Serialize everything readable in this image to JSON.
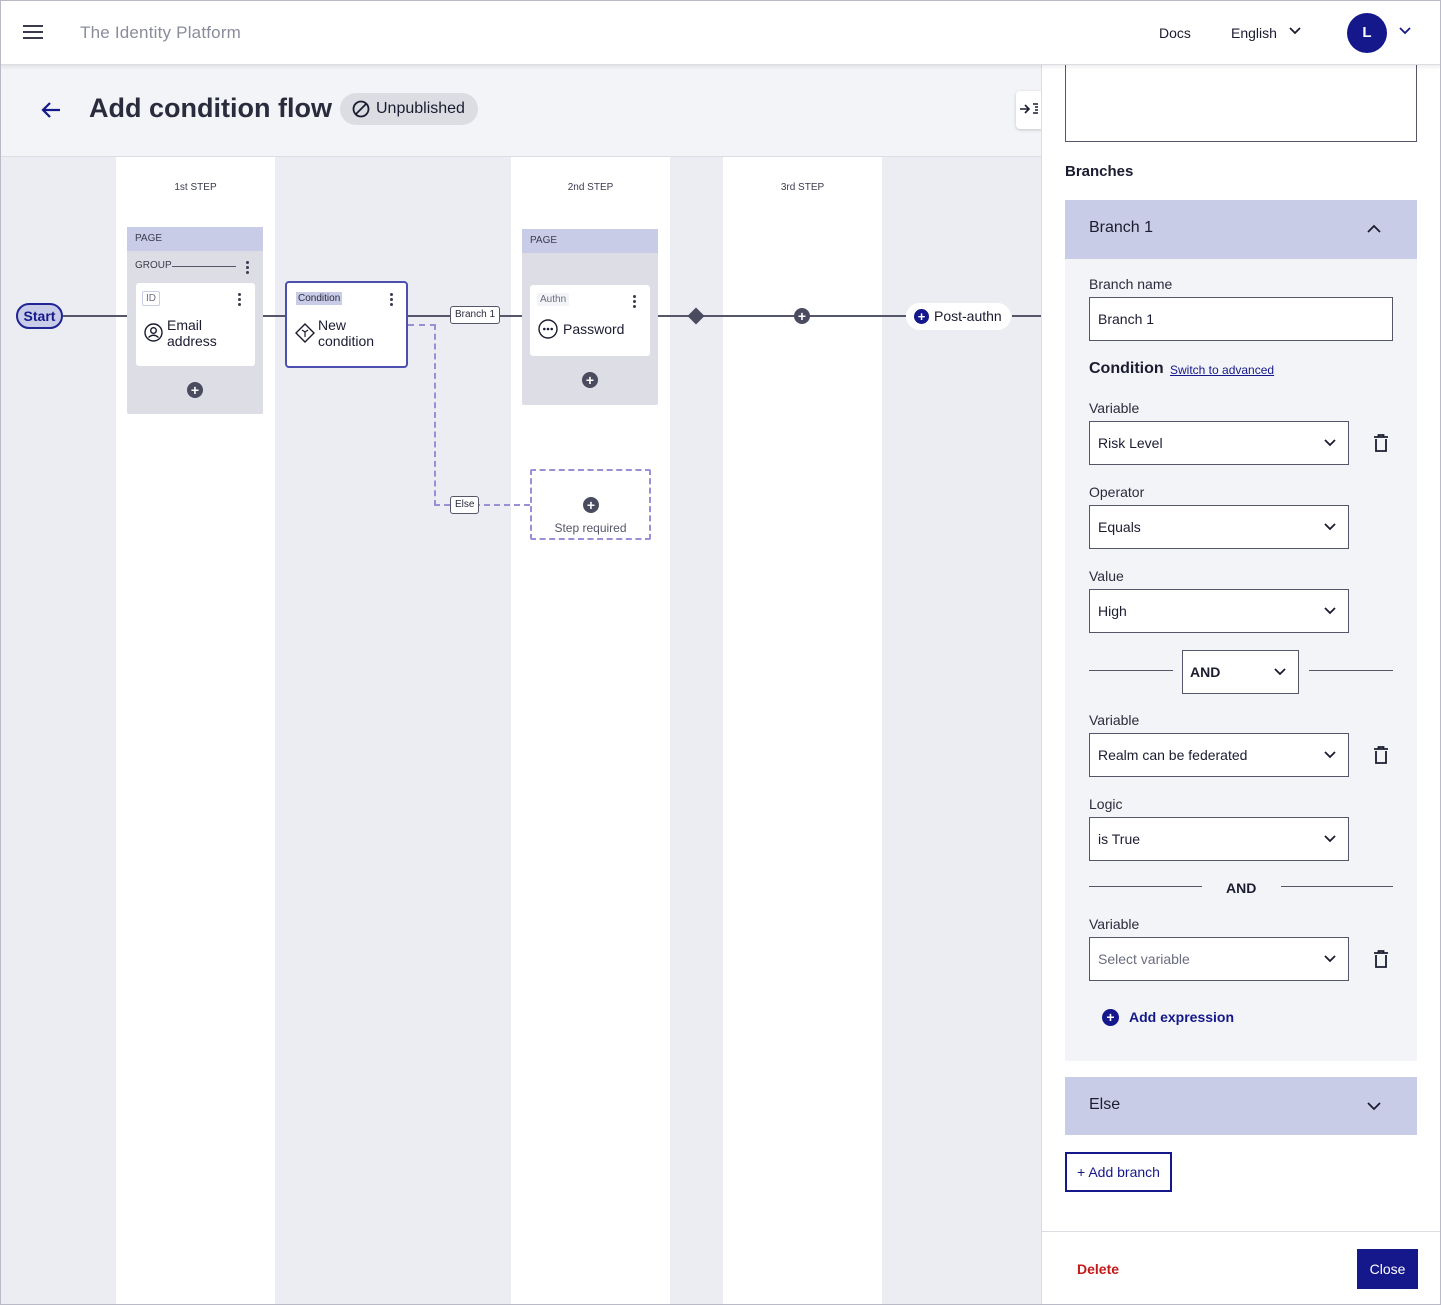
{
  "app": {
    "title": "The Identity Platform"
  },
  "topbar": {
    "docs": "Docs",
    "language": "English",
    "avatar_initial": "L"
  },
  "header": {
    "title": "Add condition flow",
    "status": "Unpublished"
  },
  "canvas": {
    "steps": [
      "1st STEP",
      "2nd STEP",
      "3rd STEP"
    ],
    "start": "Start",
    "step1": {
      "page_label": "PAGE",
      "group_label": "GROUP",
      "node_tag": "ID",
      "node_line1": "Email",
      "node_line2": "address"
    },
    "condition": {
      "tag": "Condition",
      "line1": "New",
      "line2": "condition"
    },
    "branch_label": "Branch 1",
    "else_label": "Else",
    "step2": {
      "page_label": "PAGE",
      "node_tag": "Authn",
      "node_label": "Password"
    },
    "step_required": "Step required",
    "post_authn": "Post-authn"
  },
  "panel": {
    "branches_title": "Branches",
    "branch1": {
      "title": "Branch 1",
      "name_label": "Branch name",
      "name_value": "Branch 1",
      "condition_title": "Condition",
      "advanced_link": "Switch to advanced",
      "variable_label": "Variable",
      "variable1": "Risk Level",
      "operator_label": "Operator",
      "operator1": "Equals",
      "value_label": "Value",
      "value1": "High",
      "and_selector": "AND",
      "variable2": "Realm can be federated",
      "logic_label": "Logic",
      "logic2": "is True",
      "and_static": "AND",
      "variable3_placeholder": "Select variable",
      "add_expression": "Add expression"
    },
    "else_title": "Else",
    "add_branch": "+ Add branch",
    "delete": "Delete",
    "close": "Close"
  },
  "colors": {
    "brand": "#15188a",
    "danger": "#c41a1a",
    "accordion": "#c9cce6",
    "dashed": "#9a8fd6"
  }
}
